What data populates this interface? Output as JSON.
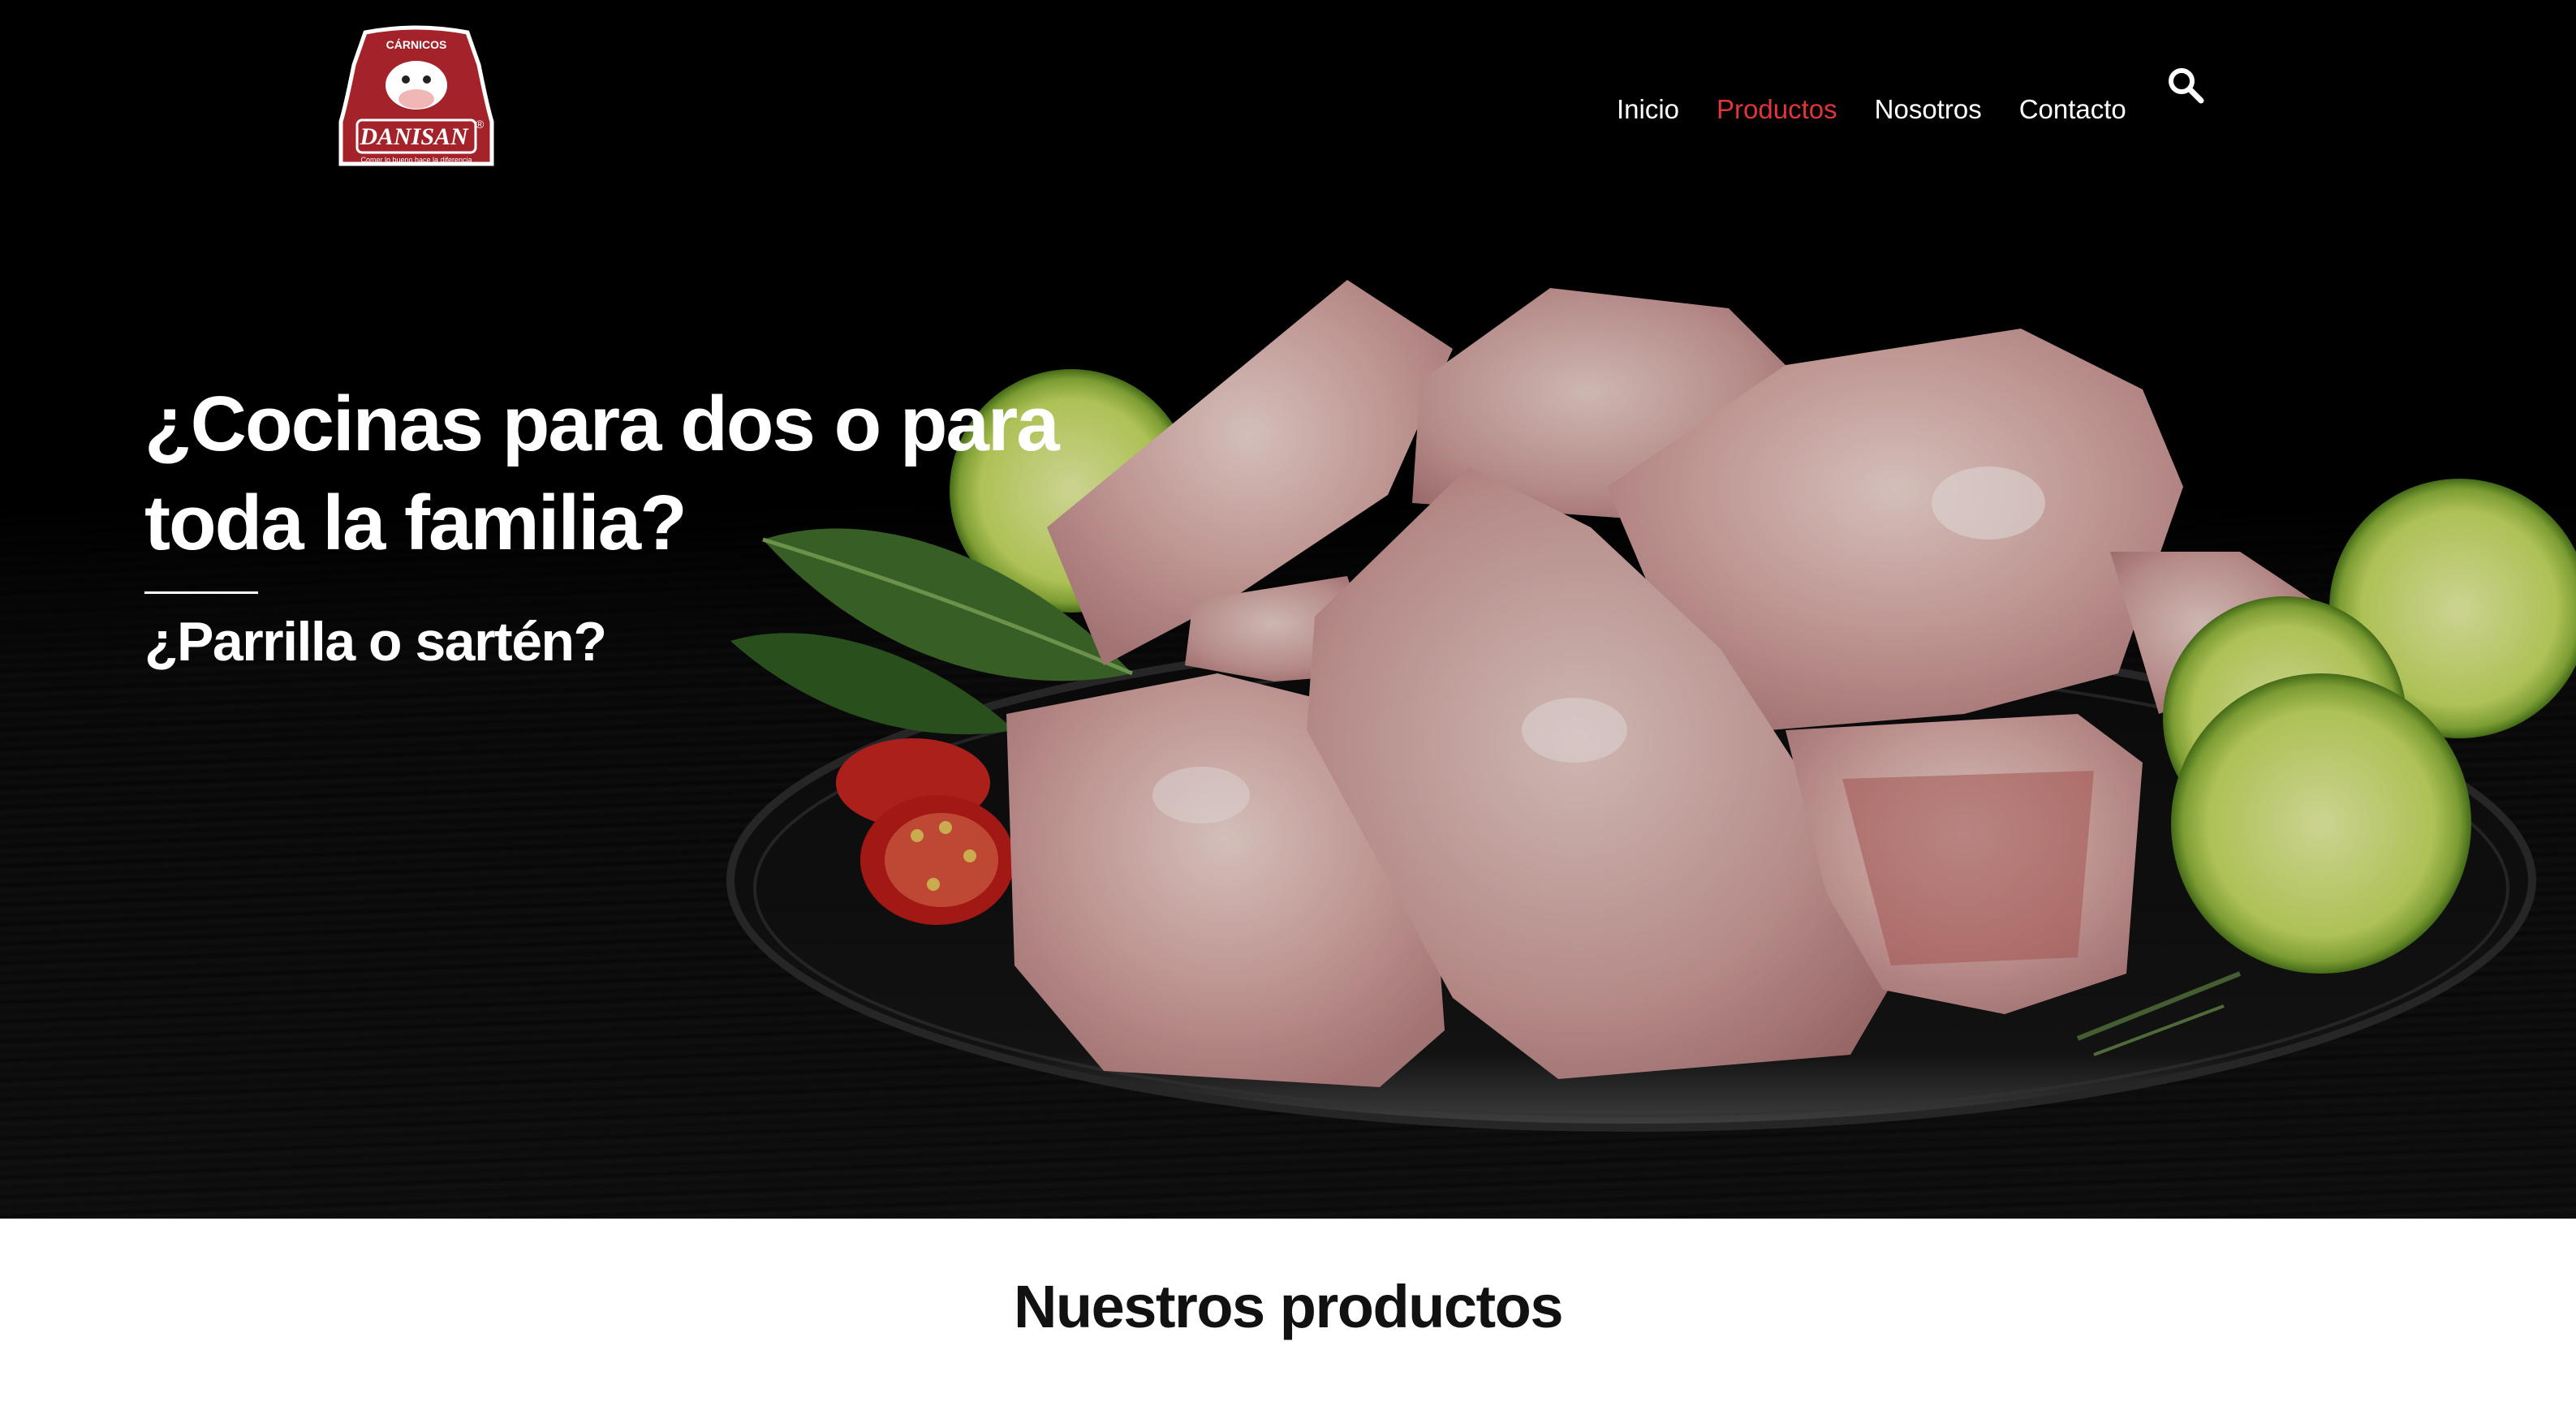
{
  "brand": {
    "name": "DANISAN",
    "top_label": "CÁRNICOS",
    "tagline": "Comer lo bueno hace la diferencia",
    "registered_mark": "®",
    "colors": {
      "primary": "#a4232b",
      "accent": "#e0353b"
    }
  },
  "nav": {
    "items": [
      {
        "label": "Inicio",
        "active": false
      },
      {
        "label": "Productos",
        "active": true
      },
      {
        "label": "Nosotros",
        "active": false
      },
      {
        "label": "Contacto",
        "active": false
      }
    ],
    "search_icon": "search-icon"
  },
  "hero": {
    "title_line1": "¿Cocinas para dos o para",
    "title_line2": "toda la familia?",
    "subtitle": "¿Parrilla o sartén?"
  },
  "products_section": {
    "title": "Nuestros productos"
  }
}
